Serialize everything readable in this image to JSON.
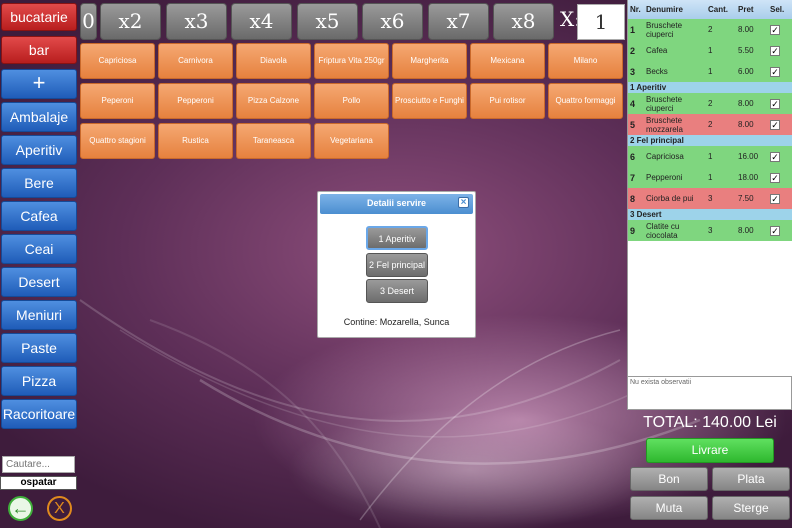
{
  "locations": [
    "bucatarie",
    "bar"
  ],
  "categories": [
    "+",
    "Ambalaje",
    "Aperitiv",
    "Bere",
    "Cafea",
    "Ceai",
    "Desert",
    "Meniuri",
    "Paste",
    "Pizza",
    "Racoritoare"
  ],
  "search": {
    "placeholder": "Cautare..."
  },
  "waiter_label": "ospatar",
  "multipliers": [
    "0",
    "x2",
    "x3",
    "x4",
    "x5",
    "x6",
    "x7",
    "x8"
  ],
  "multiplier_custom": {
    "label": "X:",
    "value": "1"
  },
  "products": [
    "Capriciosa",
    "Carnivora",
    "Diavola",
    "Friptura Vita 250gr",
    "Margherita",
    "Mexicana",
    "Milano",
    "Peperoni",
    "Pepperoni",
    "Pizza Calzone",
    "Pollo",
    "Prosciutto e Funghi",
    "Pui rotisor",
    "Quattro formaggi",
    "Quattro stagioni",
    "Rustica",
    "Taraneasca",
    "Vegetariana"
  ],
  "order": {
    "columns": [
      "Nr.",
      "Denumire",
      "Cant.",
      "Pret",
      "Sel."
    ],
    "sections": [
      {
        "group": "",
        "rows": [
          {
            "nr": "1",
            "name": "Bruschete ciuperci",
            "qty": "2",
            "price": "8.00",
            "sel": true,
            "status": "green"
          },
          {
            "nr": "2",
            "name": "Cafea",
            "qty": "1",
            "price": "5.50",
            "sel": true,
            "status": "green"
          },
          {
            "nr": "3",
            "name": "Becks",
            "qty": "1",
            "price": "6.00",
            "sel": true,
            "status": "green"
          }
        ]
      },
      {
        "group": "1 Aperitiv",
        "rows": [
          {
            "nr": "4",
            "name": "Bruschete ciuperci",
            "qty": "2",
            "price": "8.00",
            "sel": true,
            "status": "green"
          },
          {
            "nr": "5",
            "name": "Bruschete mozzarela",
            "qty": "2",
            "price": "8.00",
            "sel": true,
            "status": "red"
          }
        ]
      },
      {
        "group": "2 Fel principal",
        "rows": [
          {
            "nr": "6",
            "name": "Capriciosa",
            "qty": "1",
            "price": "16.00",
            "sel": true,
            "status": "green"
          },
          {
            "nr": "7",
            "name": "Pepperoni",
            "qty": "1",
            "price": "18.00",
            "sel": true,
            "status": "green"
          },
          {
            "nr": "8",
            "name": "Ciorba de pui",
            "qty": "3",
            "price": "7.50",
            "sel": true,
            "status": "red"
          }
        ]
      },
      {
        "group": "3 Desert",
        "rows": [
          {
            "nr": "9",
            "name": "Clatite cu ciocolata",
            "qty": "3",
            "price": "8.00",
            "sel": true,
            "status": "green"
          }
        ]
      }
    ]
  },
  "notes": "Nu exista observatii",
  "total": "TOTAL: 140.00 Lei",
  "actions": {
    "deliver": "Livrare",
    "order_ticket": "Bon Comanda",
    "pay": "Plata",
    "move": "Muta",
    "delete": "Sterge"
  },
  "modal": {
    "title": "Detalii servire",
    "options": [
      "1 Aperitiv",
      "2 Fel principal",
      "3 Desert"
    ],
    "selected": "1 Aperitiv",
    "contains": "Contine: Mozarella, Sunca"
  },
  "colors": {
    "location": "#c62828",
    "category": "#2a6fcf",
    "product": "#ee9452",
    "deliver": "#3dc73d",
    "served": "#7fd67f",
    "pending": "#e97f7f"
  }
}
